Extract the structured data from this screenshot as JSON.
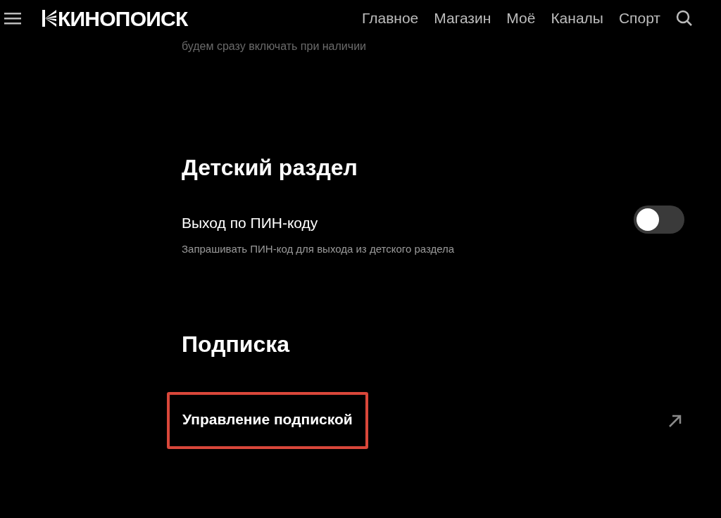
{
  "header": {
    "logo": "КИНОПОИСК",
    "nav": [
      {
        "label": "Главное"
      },
      {
        "label": "Магазин"
      },
      {
        "label": "Моё"
      },
      {
        "label": "Каналы"
      },
      {
        "label": "Спорт"
      }
    ]
  },
  "partial_text": "будем сразу включать при наличии",
  "sections": [
    {
      "title": "Детский раздел",
      "settings": [
        {
          "kind": "toggle",
          "label": "Выход по ПИН-коду",
          "description": "Запрашивать ПИН-код для выхода из детского раздела",
          "on": false
        }
      ]
    },
    {
      "title": "Подписка",
      "settings": [
        {
          "kind": "link",
          "label": "Управление подпиской",
          "highlighted": true
        }
      ]
    }
  ]
}
